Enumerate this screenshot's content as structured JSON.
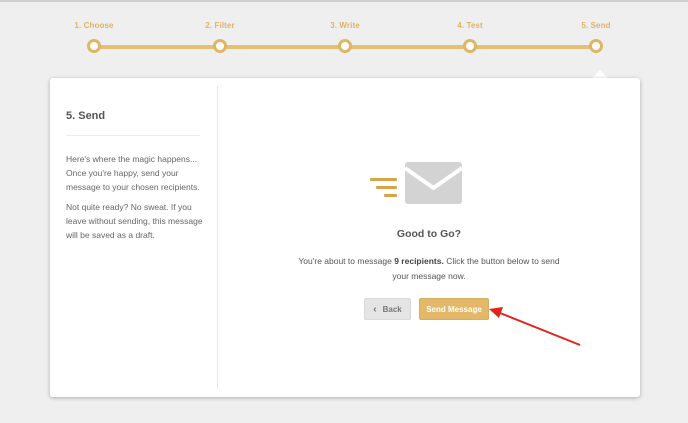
{
  "stepper": {
    "steps": [
      {
        "label": "1. Choose"
      },
      {
        "label": "2. Filter"
      },
      {
        "label": "3. Write"
      },
      {
        "label": "4. Test"
      },
      {
        "label": "5. Send"
      }
    ],
    "current_step": 5,
    "accent_color": "#e0b565"
  },
  "sidebar": {
    "title": "5. Send",
    "paragraph1": "Here's where the magic happens... Once you're happy, send your message to your chosen recipients.",
    "paragraph2": "Not quite ready? No sweat. If you leave without sending, this message will be saved as a draft."
  },
  "main": {
    "icon": "envelope-icon",
    "title": "Good to Go?",
    "desc_pre": "You're about to message ",
    "desc_bold": "9 recipients.",
    "desc_post": " Click the button below to send your message now.",
    "back_label": "Back",
    "send_label": "Send Message"
  },
  "annotation": {
    "type": "red-arrow",
    "color": "#e0261b"
  }
}
